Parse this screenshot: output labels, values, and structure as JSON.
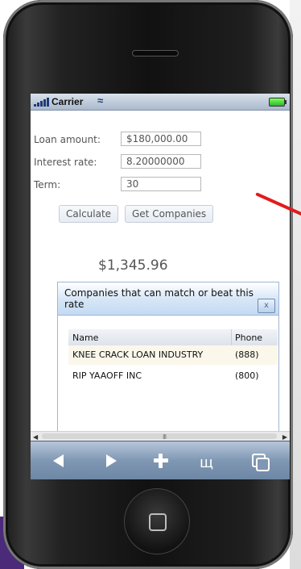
{
  "status_bar": {
    "carrier": "Carrier"
  },
  "form": {
    "loan_amount": {
      "label": "Loan amount:",
      "value": "$180,000.00"
    },
    "interest_rate": {
      "label": "Interest rate:",
      "value": "8.20000000"
    },
    "term": {
      "label": "Term:",
      "value": "30"
    },
    "calculate_label": "Calculate",
    "get_companies_label": "Get Companies"
  },
  "result": {
    "payment": "$1,345.96"
  },
  "dialog": {
    "title": "Companies that can match or beat this rate",
    "close_label": "x",
    "columns": [
      "Name",
      "Phone"
    ],
    "rows": [
      {
        "name": "KNEE CRACK LOAN INDUSTRY",
        "phone": "(888)"
      },
      {
        "name": "RIP YAAOFF INC",
        "phone": "(800)"
      }
    ]
  },
  "scrollbar": {
    "grip": "III"
  },
  "icons": {
    "back": "back-arrow-icon",
    "forward": "forward-arrow-icon",
    "add": "plus-icon",
    "bookmarks": "book-icon",
    "pages": "pages-icon"
  },
  "colors": {
    "accent_red": "#e21b1b",
    "toolbar_blue": "#7f97b3",
    "dialog_header": "#c3daf3"
  }
}
